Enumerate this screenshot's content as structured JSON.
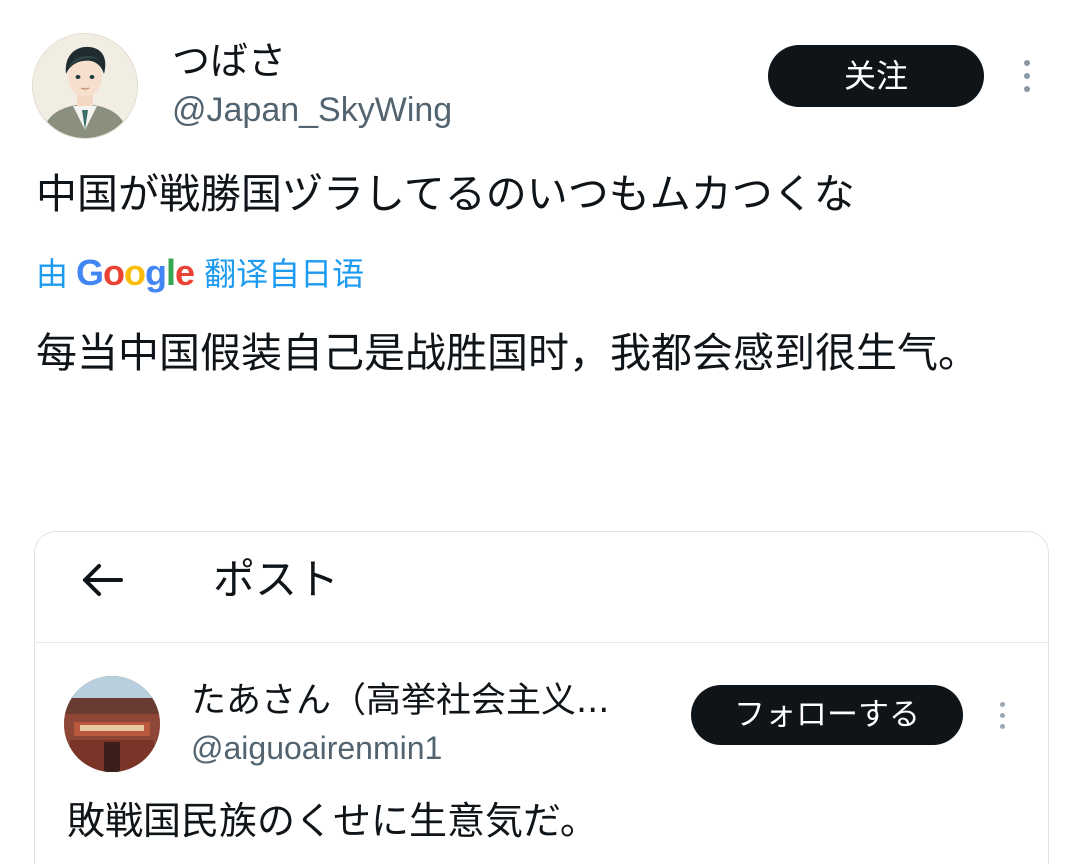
{
  "tweet": {
    "author": {
      "display_name": "つばさ",
      "handle": "@Japan_SkyWing",
      "avatar_icon": "avatar-illustrated-man"
    },
    "follow_label": "关注",
    "more_icon": "more-vertical-icon",
    "text": "中国が戦勝国ヅラしてるのいつもムカつくな",
    "translation": {
      "prefix": "由",
      "provider": "Google",
      "suffix": "翻译自日语",
      "text": "每当中国假装自己是战胜国时，我都会感到很生气。"
    }
  },
  "embedded_screenshot": {
    "back_icon": "arrow-left-icon",
    "title": "ポスト",
    "quoted_post": {
      "display_name": "たあさん（高挙社会主义...",
      "handle": "@aiguoairenmin1",
      "follow_label": "フォローする",
      "more_icon": "more-vertical-icon",
      "text": "敗戦国民族のくせに生意気だ。"
    }
  },
  "colors": {
    "text_primary": "#0f1419",
    "text_secondary": "#536471",
    "link_blue": "#1d9bf0",
    "button_bg": "#0f1419",
    "button_text": "#ffffff",
    "border": "#dfe3e6"
  }
}
